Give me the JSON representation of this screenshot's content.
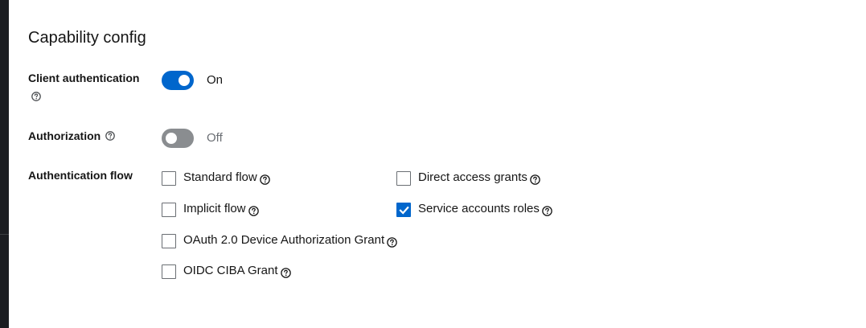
{
  "section": {
    "title": "Capability config"
  },
  "client_authentication": {
    "label": "Client authentication",
    "state": "On",
    "enabled": true
  },
  "authorization": {
    "label": "Authorization",
    "state": "Off",
    "enabled": false
  },
  "authentication_flow": {
    "label": "Authentication flow",
    "options": [
      {
        "label": "Standard flow",
        "checked": false
      },
      {
        "label": "Direct access grants",
        "checked": false
      },
      {
        "label": "Implicit flow",
        "checked": false
      },
      {
        "label": "Service accounts roles",
        "checked": true
      },
      {
        "label": "OAuth 2.0 Device Authorization Grant",
        "checked": false
      },
      {
        "label": "OIDC CIBA Grant",
        "checked": false
      }
    ]
  },
  "colors": {
    "accent": "#0066cc",
    "switch_off": "#8a8d90",
    "text": "#151515",
    "muted_text": "#6a6e73"
  },
  "icons": {
    "help": "question-circle-icon",
    "check": "checkmark-icon"
  }
}
